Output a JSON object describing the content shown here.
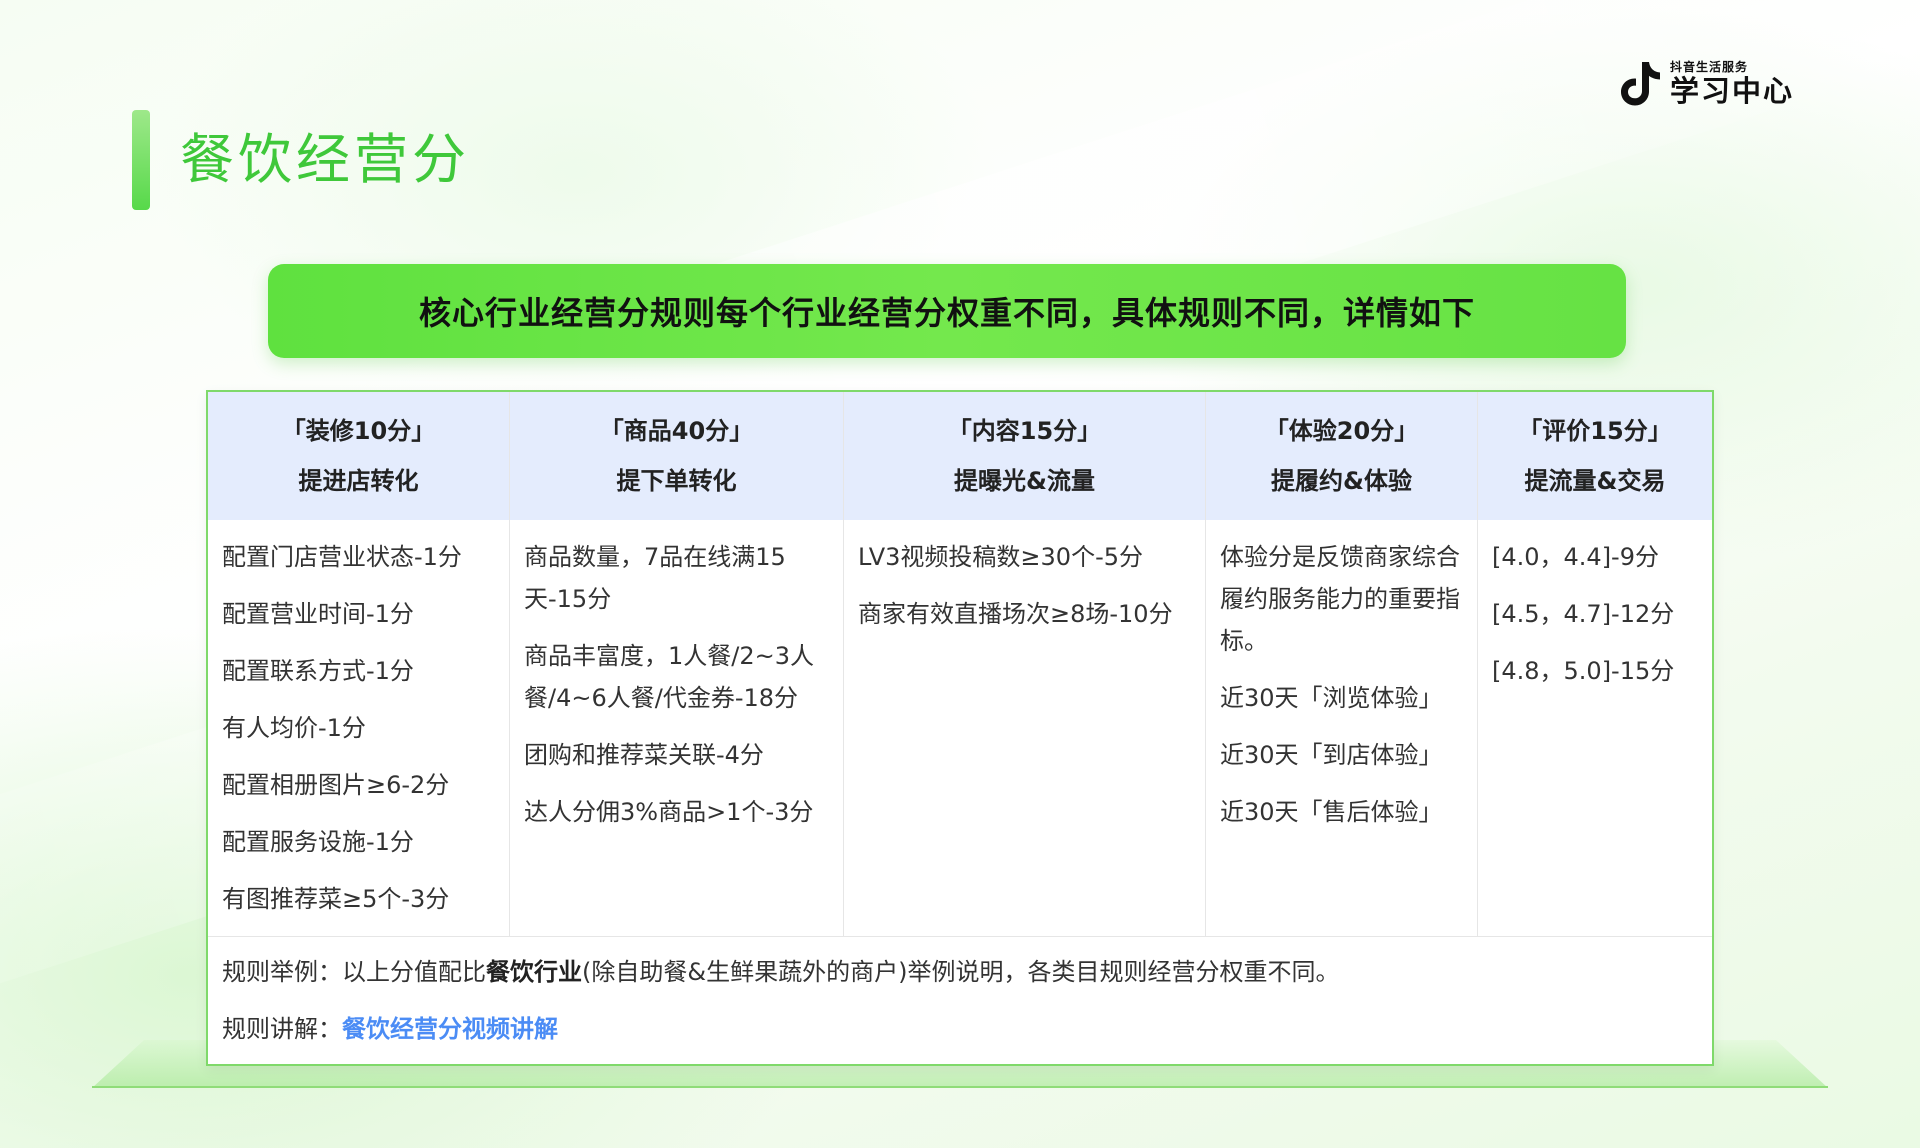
{
  "brand": {
    "sub": "抖音生活服务",
    "main": "学习中心"
  },
  "page": {
    "title": "餐饮经营分"
  },
  "banner": {
    "text": "核心行业经营分规则每个行业经营分权重不同，具体规则不同，详情如下"
  },
  "columns": [
    {
      "heading": "「装修10分」",
      "subheading": "提进店转化",
      "items": [
        "配置门店营业状态-1分",
        "配置营业时间-1分",
        "配置联系方式-1分",
        "有人均价-1分",
        "配置相册图片≥6-2分",
        "配置服务设施-1分",
        "有图推荐菜≥5个-3分"
      ]
    },
    {
      "heading": "「商品40分」",
      "subheading": "提下单转化",
      "items": [
        "商品数量，7品在线满15天-15分",
        "商品丰富度，1人餐/2~3人餐/4~6人餐/代金券-18分",
        "团购和推荐菜关联-4分",
        "达人分佣3%商品>1个-3分"
      ]
    },
    {
      "heading": "「内容15分」",
      "subheading": "提曝光&流量",
      "items": [
        "LV3视频投稿数≥30个-5分",
        "商家有效直播场次≥8场-10分"
      ]
    },
    {
      "heading": "「体验20分」",
      "subheading": "提履约&体验",
      "items": [
        "体验分是反馈商家综合履约服务能力的重要指标。",
        "近30天「浏览体验」",
        "近30天「到店体验」",
        "近30天「售后体验」"
      ]
    },
    {
      "heading": "「评价15分」",
      "subheading": "提流量&交易",
      "items": [
        "[4.0，4.4]-9分",
        "[4.5，4.7]-12分",
        "[4.8，5.0]-15分"
      ]
    }
  ],
  "footer": {
    "example_label": "规则举例：",
    "example_pre": "以上分值配比",
    "example_bold": "餐饮行业",
    "example_post": "(除自助餐&生鲜果蔬外的商户)举例说明，各类目规则经营分权重不同。",
    "explain_label": "规则讲解：",
    "explain_link": "餐饮经营分视频讲解"
  }
}
